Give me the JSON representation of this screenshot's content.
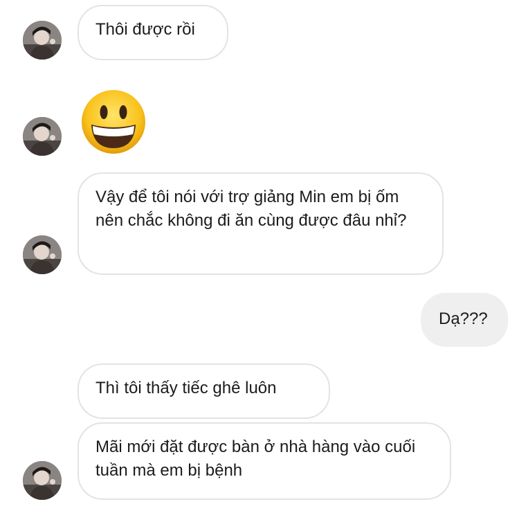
{
  "messages": [
    {
      "from": "them",
      "text": "Thôi được rồi"
    },
    {
      "from": "them",
      "type": "emoji",
      "emoji": "smiling-face-with-open-mouth"
    },
    {
      "from": "them",
      "text": "Vậy để tôi nói với trợ giảng Min em bị ốm nên chắc không đi ăn cùng được đâu nhỉ?"
    },
    {
      "from": "me",
      "text": "Dạ???"
    },
    {
      "from": "them",
      "text": "Thì tôi thấy tiếc ghê luôn"
    },
    {
      "from": "them",
      "text": "Mãi mới đặt được bàn ở nhà hàng vào cuối tuần mà em bị bệnh"
    }
  ],
  "colors": {
    "incoming_bubble_border": "#e3e3e3",
    "outgoing_bubble_bg": "#efefef",
    "text": "#1b1b1b"
  }
}
